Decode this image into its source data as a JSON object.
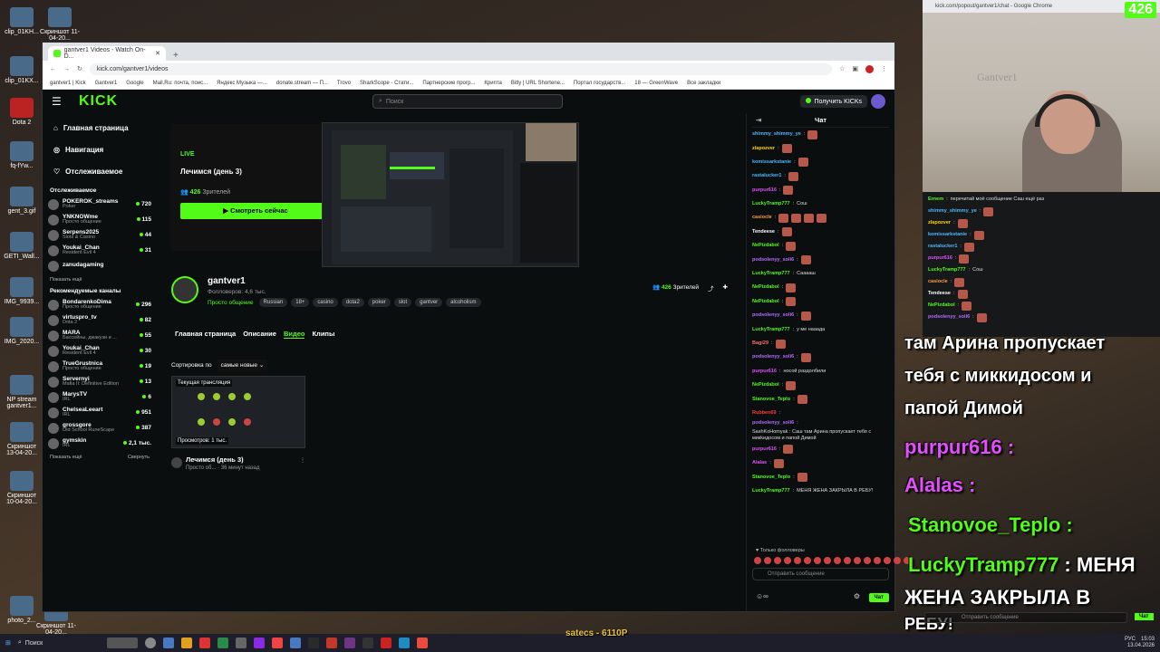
{
  "desktop": {
    "icons": [
      {
        "label": "clip_01KH..."
      },
      {
        "label": "Скриншот 11-04-20..."
      },
      {
        "label": "clip_01KX..."
      },
      {
        "label": "Dota 2"
      },
      {
        "label": "fq-fYw..."
      },
      {
        "label": "gent_3.gif"
      },
      {
        "label": "GETI_Wall..."
      },
      {
        "label": "IMG_9939..."
      },
      {
        "label": "IMG_2020..."
      },
      {
        "label": "NP stream gantver1..."
      },
      {
        "label": "Скриншот 13-04-20..."
      },
      {
        "label": "Скриншот 10-04-20..."
      },
      {
        "label": "photo_2..."
      },
      {
        "label": "Скриншот 11-04-20..."
      }
    ]
  },
  "browser": {
    "tab_title": "gantver1 Videos - Watch On-D...",
    "url": "kick.com/gantver1/videos",
    "bookmarks": [
      "gantver1 | Kick",
      "Gantver1",
      "Google",
      "Mail.Ru: почта, поис...",
      "Яндекс Музыка —...",
      "donate.stream — П...",
      "Trovo",
      "SharkScope - Стати...",
      "Партнерские прогр...",
      "Крипта",
      "Bitly | URL Shortene...",
      "Портал государств...",
      "18 — GreenWave",
      "Все закладки"
    ]
  },
  "kick": {
    "logo": "KICK",
    "search_placeholder": "Поиск",
    "get_kicks": "Получить KICKs",
    "nav": [
      {
        "label": "Главная страница"
      },
      {
        "label": "Навигация"
      },
      {
        "label": "Отслеживаемое"
      }
    ],
    "following_header": "Отслеживаемое",
    "following": [
      {
        "name": "POKEROK_streams",
        "cat": "Poker",
        "count": "720"
      },
      {
        "name": "YNKNOWme",
        "cat": "Просто общение",
        "count": "115"
      },
      {
        "name": "Serpens2025",
        "cat": "Slots & Casino",
        "count": "44"
      },
      {
        "name": "Youkai_Chan",
        "cat": "Resident Evil 4",
        "count": "31"
      },
      {
        "name": "zanudagaming",
        "cat": "",
        "count": ""
      }
    ],
    "show_more": "Показать ещё",
    "recommended_header": "Рекомендуемые каналы",
    "recommended": [
      {
        "name": "BondarenkoDima",
        "cat": "Просто общение",
        "count": "296"
      },
      {
        "name": "virtuspro_tv",
        "cat": "Dota 2",
        "count": "82"
      },
      {
        "name": "MARA",
        "cat": "Бассейны, джакузи и ...",
        "count": "55"
      },
      {
        "name": "Youkai_Chan",
        "cat": "Resident Evil 4",
        "count": "30"
      },
      {
        "name": "TrueGrustnica",
        "cat": "Просто общение",
        "count": "19"
      },
      {
        "name": "Servernyi",
        "cat": "Mafia II: Definitive Edition",
        "count": "13"
      },
      {
        "name": "MarysTV",
        "cat": "IRL",
        "count": "6"
      },
      {
        "name": "ChelseaLeeart",
        "cat": "IRL",
        "count": "951"
      },
      {
        "name": "grossgore",
        "cat": "Old School RuneScape",
        "count": "387"
      },
      {
        "name": "gymskin",
        "cat": "IRL",
        "count": "2,1 тыс."
      }
    ],
    "show_more_2": "Показать ещё",
    "collapse": "Свернуть",
    "hero": {
      "live": "LIVE",
      "title": "Лечимся (день 3)",
      "viewers_count": "426",
      "viewers_label": "Зрителей",
      "watch_button": "Смотреть сейчас"
    },
    "channel": {
      "name": "gantver1",
      "followers": "Фолловеров: 4,6 тыс.",
      "category": "Просто общение",
      "tags": [
        "Russian",
        "18+",
        "casino",
        "dota2",
        "poker",
        "slot",
        "gantver",
        "alcoholism"
      ],
      "viewers_count": "426",
      "viewers_label": "Зрителей"
    },
    "tabs": [
      "Главная страница",
      "Описание",
      "Видео",
      "Клипы"
    ],
    "sort_label": "Сортировка по",
    "sort_value": "самые новые",
    "video": {
      "badge": "Текущая трансляция",
      "views": "Просмотров: 1 тыс.",
      "title": "Лечимся (день 3)",
      "meta": "Просто об... · 36 минут назад"
    },
    "chat": {
      "title": "Чат",
      "messages": [
        {
          "user": "shimmy_shimmy_ye",
          "color": "#4fb6ff",
          "text": "",
          "emotes": 1
        },
        {
          "user": "zlapozver",
          "color": "#ffd700",
          "text": "",
          "emotes": 1
        },
        {
          "user": "komissarkstanie",
          "color": "#4fb6ff",
          "text": "",
          "emotes": 1
        },
        {
          "user": "rastalucker1",
          "color": "#4fb6ff",
          "text": "",
          "emotes": 1
        },
        {
          "user": "purpur616",
          "color": "#e34fff",
          "text": "",
          "emotes": 1
        },
        {
          "user": "LuckyTramp777",
          "color": "#53fc18",
          "text": "Сош",
          "emotes": 0
        },
        {
          "user": "casiocle",
          "color": "#ff9c3b",
          "text": "",
          "emotes": 4
        },
        {
          "user": "Tendeese",
          "color": "#ffffff",
          "text": "",
          "emotes": 1
        },
        {
          "user": "NePizdabol",
          "color": "#53fc18",
          "text": "",
          "emotes": 1
        },
        {
          "user": "podsolenyy_soli6",
          "color": "#b56bff",
          "text": "",
          "emotes": 1
        },
        {
          "user": "LuckyTramp777",
          "color": "#53fc18",
          "text": "Сааааш",
          "emotes": 0
        },
        {
          "user": "NePizdabol",
          "color": "#53fc18",
          "text": "",
          "emotes": 1
        },
        {
          "user": "NePizdabol",
          "color": "#53fc18",
          "text": "",
          "emotes": 1
        },
        {
          "user": "podsolenyy_soli6",
          "color": "#b56bff",
          "text": "",
          "emotes": 1
        },
        {
          "user": "LuckyTramp777",
          "color": "#53fc18",
          "text": "у ме нааада",
          "emotes": 0
        },
        {
          "user": "Bagi29",
          "color": "#ff6b6b",
          "text": "",
          "emotes": 1
        },
        {
          "user": "podsolenyy_soli6",
          "color": "#b56bff",
          "text": "",
          "emotes": 1
        },
        {
          "user": "purpur616",
          "color": "#e34fff",
          "text": "носой раздолбили",
          "emotes": 0
        },
        {
          "user": "NePizdabol",
          "color": "#53fc18",
          "text": "",
          "emotes": 1
        },
        {
          "user": "Stanovoe_Teplo",
          "color": "#53fc18",
          "text": "",
          "emotes": 1
        },
        {
          "user": "Rubben69",
          "color": "#ff3b3b",
          "text": "",
          "emotes": 0
        },
        {
          "user": "podsolenyy_soli6",
          "color": "#b56bff",
          "text": "SashKoHomyak : Саш там Арина пропускает тебя с микkидосом и папой Димой",
          "emotes": 0
        },
        {
          "user": "purpur616",
          "color": "#e34fff",
          "text": "",
          "emotes": 1
        },
        {
          "user": "Alalas",
          "color": "#e34fff",
          "text": "",
          "emotes": 1
        },
        {
          "user": "Stanovoe_Teplo",
          "color": "#53fc18",
          "text": "",
          "emotes": 1
        },
        {
          "user": "LuckyTramp777",
          "color": "#53fc18",
          "text": "МЕНЯ ЖЕНА ЗАКРЫЛА В РЕБУ!",
          "emotes": 0
        }
      ],
      "followers_only": "Только фолловеры",
      "input_placeholder": "Отправить сообщение",
      "send": "Чат"
    }
  },
  "overlay": {
    "popup_url": "kick.com/popout/gantver1/chat - Google Chrome",
    "viewer_count": "426",
    "ghost_text": "Gantver1",
    "messages": [
      {
        "user": "Ernem",
        "color": "#53fc18",
        "text": "перечитай моё сообщение Саш ещё раз"
      },
      {
        "user": "shimmy_shimmy_ye",
        "color": "#4fb6ff",
        "text": ""
      },
      {
        "user": "zlapozver",
        "color": "#ffd700",
        "text": ""
      },
      {
        "user": "komissarkstanie",
        "color": "#4fb6ff",
        "text": ""
      },
      {
        "user": "rastalucker1",
        "color": "#4fb6ff",
        "text": ""
      },
      {
        "user": "purpur616",
        "color": "#e34fff",
        "text": ""
      },
      {
        "user": "LuckyTramp777",
        "color": "#53fc18",
        "text": "Сош"
      },
      {
        "user": "casiocle",
        "color": "#ff9c3b",
        "text": ""
      },
      {
        "user": "Tendeese",
        "color": "#ffffff",
        "text": ""
      },
      {
        "user": "NePizdabol",
        "color": "#53fc18",
        "text": ""
      },
      {
        "user": "podsolenyy_soli6",
        "color": "#b56bff",
        "text": ""
      }
    ],
    "big": {
      "line1": "там Арина пропускает",
      "line2": "тебя с миккидосом и",
      "line3": "папой Димой",
      "u1": "purpur616",
      "u2": "Alalas",
      "u3": "Stanovoe_Teplo",
      "u4": "LuckyTramp777",
      "m4": "МЕНЯ",
      "m5": "ЖЕНА ЗАКРЫЛА В",
      "m6": "РЕБУ!"
    },
    "input_placeholder": "Отправить сообщение",
    "send": "Чат"
  },
  "taskbar": {
    "search": "Поиск",
    "ticker": "satecs - 6110P",
    "time": "15:03",
    "date": "13.04.2026",
    "lang": "РУС"
  }
}
